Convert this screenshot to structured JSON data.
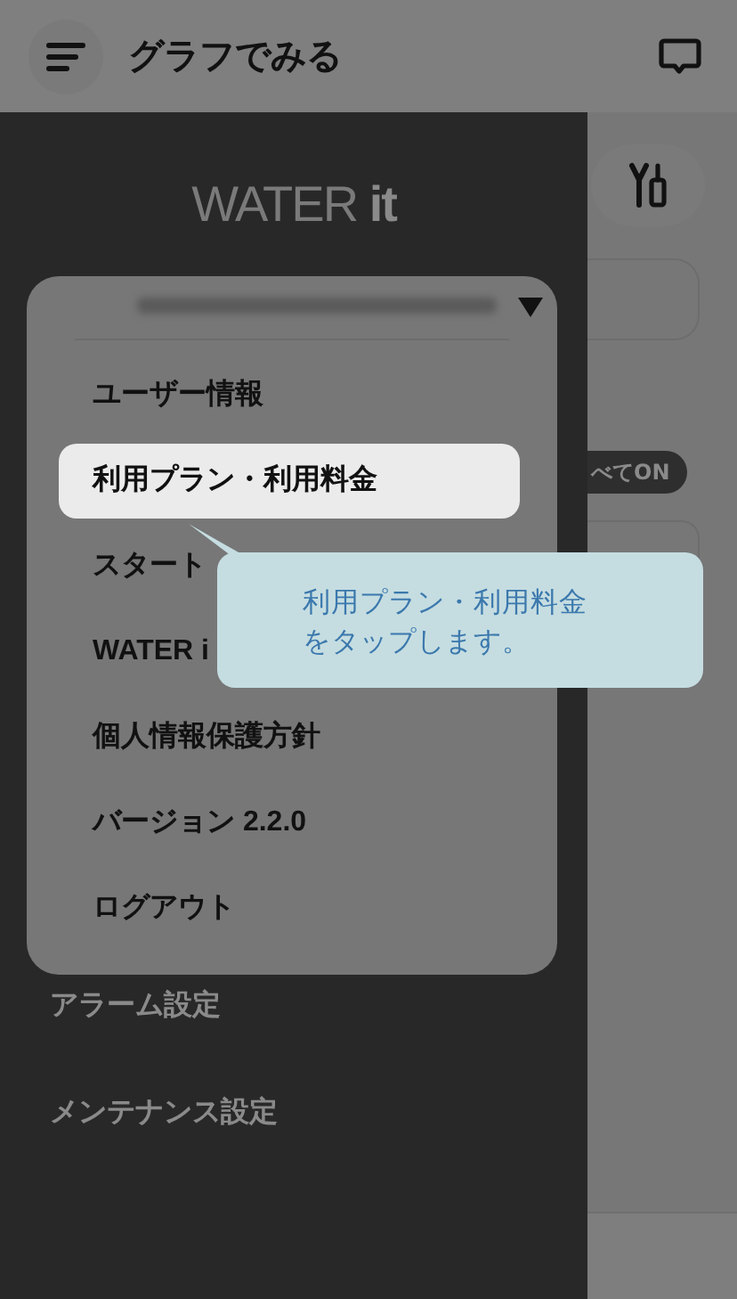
{
  "header": {
    "title": "グラフでみる"
  },
  "background": {
    "all_on_button": {
      "label": "べてON"
    }
  },
  "drawer": {
    "logo": "WATER **it**",
    "items": [
      {
        "label": "アラーム設定"
      },
      {
        "label": "メンテナンス設定"
      }
    ]
  },
  "account_menu": {
    "items": [
      {
        "label": "ユーザー情報",
        "selected": false
      },
      {
        "label": "利用プラン・利用料金",
        "selected": true
      },
      {
        "label": "スタート",
        "selected": false
      },
      {
        "label": "WATER i",
        "selected": false
      },
      {
        "label": "個人情報保護方針",
        "selected": false
      },
      {
        "label": "バージョン 2.2.0",
        "selected": false
      },
      {
        "label": "ログアウト",
        "selected": false
      }
    ]
  },
  "callout": {
    "lines": [
      "利用プラン・利用料金",
      "をタップします。"
    ]
  }
}
